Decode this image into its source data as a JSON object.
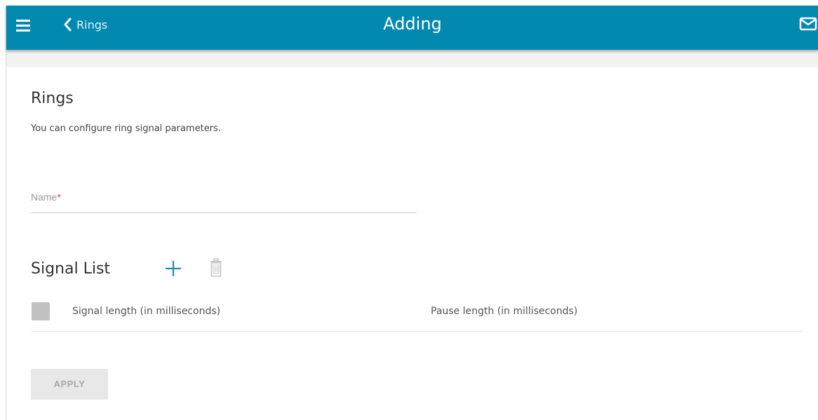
{
  "header": {
    "back_label": "Rings",
    "title": "Adding",
    "color": "#0289b0",
    "icons": [
      "menu-icon",
      "chevron-left-icon",
      "mail-icon"
    ]
  },
  "rings": {
    "title": "Rings",
    "description": "You can configure ring signal parameters."
  },
  "name_field": {
    "label": "Name",
    "required_mark": "*",
    "value": ""
  },
  "signal_list": {
    "title": "Signal List",
    "columns": [
      "Signal length (in milliseconds)",
      "Pause length (in milliseconds)"
    ],
    "rows": [],
    "icons": [
      "plus-icon",
      "trash-icon"
    ]
  },
  "actions": {
    "apply_label": "APPLY"
  }
}
